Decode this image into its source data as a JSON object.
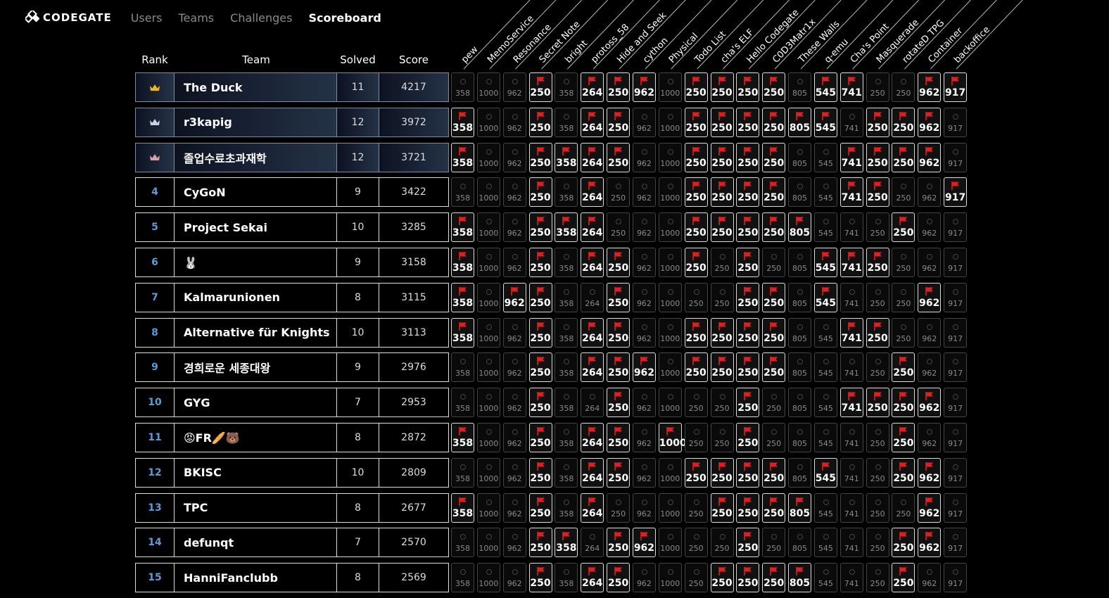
{
  "nav": {
    "logo": "CODEGATE",
    "links": [
      "Users",
      "Teams",
      "Challenges",
      "Scoreboard"
    ],
    "active": "Scoreboard"
  },
  "headers": {
    "rank": "Rank",
    "team": "Team",
    "solved": "Solved",
    "score": "Score"
  },
  "challenges": [
    {
      "name": "pew",
      "points": 358
    },
    {
      "name": "MemoService",
      "points": 1000
    },
    {
      "name": "Resonance",
      "points": 962
    },
    {
      "name": "Secret Note",
      "points": 250
    },
    {
      "name": "bright",
      "points": 358
    },
    {
      "name": "protoss_58",
      "points": 264
    },
    {
      "name": "Hide and Seek",
      "points": 250
    },
    {
      "name": "cython",
      "points": 962
    },
    {
      "name": "Physical",
      "points": 1000
    },
    {
      "name": "Todo List",
      "points": 250
    },
    {
      "name": "cha's ELF",
      "points": 250
    },
    {
      "name": "Hello Codegate",
      "points": 250
    },
    {
      "name": "C0D3Matr1x",
      "points": 250
    },
    {
      "name": "These Walls",
      "points": 805
    },
    {
      "name": "q-emu",
      "points": 545
    },
    {
      "name": "Cha's Point",
      "points": 741
    },
    {
      "name": "Masquerade",
      "points": 250
    },
    {
      "name": "rotateD TPG",
      "points": 250
    },
    {
      "name": "Container",
      "points": 962
    },
    {
      "name": "backoffice",
      "points": 917
    }
  ],
  "teams": [
    {
      "rank": "",
      "crown": "gold",
      "team": "The Duck",
      "solved": "11",
      "score": "4217",
      "solves": "00010111011110110011"
    },
    {
      "rank": "",
      "crown": "silver",
      "team": "r3kapig",
      "solved": "12",
      "score": "3972",
      "solves": "10010110011111101110"
    },
    {
      "rank": "",
      "crown": "bronze",
      "team": "졸업수료초과재학",
      "solved": "12",
      "score": "3721",
      "solves": "10011110011110011110"
    },
    {
      "rank": "4",
      "crown": "",
      "team": "CyGoN",
      "solved": "9",
      "score": "3422",
      "solves": "00010100011110011001"
    },
    {
      "rank": "5",
      "crown": "",
      "team": "Project Sekai",
      "solved": "10",
      "score": "3285",
      "solves": "10011100011111000100"
    },
    {
      "rank": "6",
      "crown": "",
      "team": "🐰",
      "solved": "9",
      "score": "3158",
      "solves": "10010110010100111000"
    },
    {
      "rank": "7",
      "crown": "",
      "team": "Kalmarunionen",
      "solved": "8",
      "score": "3115",
      "solves": "10110010000110100010"
    },
    {
      "rank": "8",
      "crown": "",
      "team": "Alternative für Knights",
      "solved": "10",
      "score": "3113",
      "solves": "10010110011110011000"
    },
    {
      "rank": "9",
      "crown": "",
      "team": "경희로운 세종대왕",
      "solved": "9",
      "score": "2976",
      "solves": "00010111011110000100"
    },
    {
      "rank": "10",
      "crown": "",
      "team": "GYG",
      "solved": "7",
      "score": "2953",
      "solves": "00010010000100011110"
    },
    {
      "rank": "11",
      "crown": "",
      "team": "😡FR🥖🐻",
      "solved": "8",
      "score": "2872",
      "solves": "10010110100100000100"
    },
    {
      "rank": "12",
      "crown": "",
      "team": "BKISC",
      "solved": "10",
      "score": "2809",
      "solves": "00010110011110100110"
    },
    {
      "rank": "13",
      "crown": "",
      "team": "TPC",
      "solved": "8",
      "score": "2677",
      "solves": "10010100001111000010"
    },
    {
      "rank": "14",
      "crown": "",
      "team": "defunqt",
      "solved": "7",
      "score": "2570",
      "solves": "00011011000100000110"
    },
    {
      "rank": "15",
      "crown": "",
      "team": "HanniFanclubb",
      "solved": "8",
      "score": "2569",
      "solves": "00010110001111000100"
    }
  ],
  "colors": {
    "flag": "#e02020",
    "gold": "#e8b923",
    "silver": "#c9d3e6",
    "bronze": "#d9a0a8",
    "rank": "#5c9bd8"
  },
  "icons": {
    "solved": "flag-icon",
    "unsolved": "circle-icon",
    "top3": "crown-icon"
  }
}
